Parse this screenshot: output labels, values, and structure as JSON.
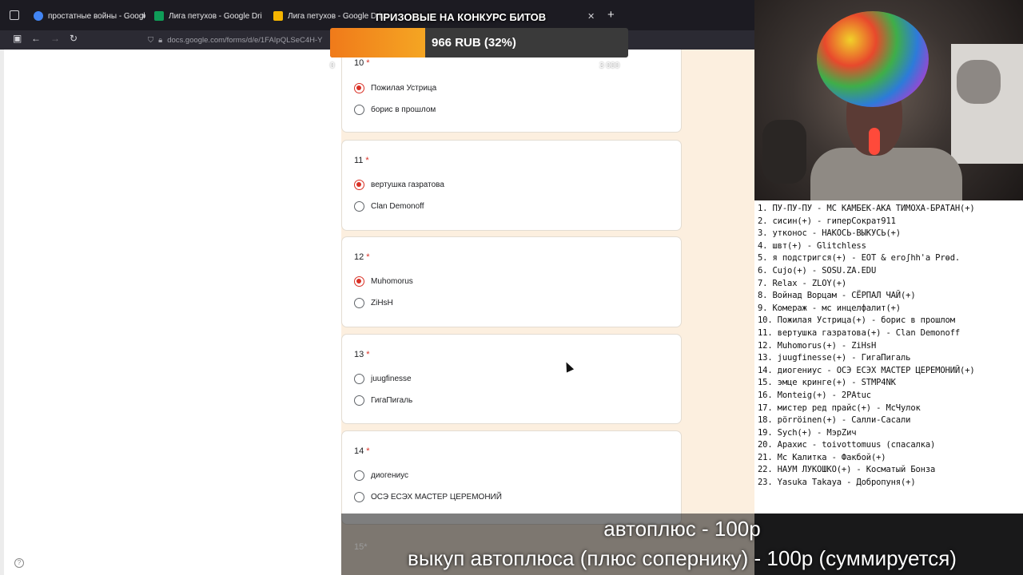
{
  "browser": {
    "tabs": [
      {
        "label": "простатные войны - Google Sh",
        "favicon_color": "#4285f4"
      },
      {
        "label": "Лига петухов - Google Drive",
        "favicon_color": "#0f9d58"
      },
      {
        "label": "Лига петухов - Google Drive",
        "favicon_color": "#f4b400"
      }
    ],
    "url": "docs.google.com/forms/d/e/1FAIpQLSeC4H-Y"
  },
  "form": {
    "questions": [
      {
        "number": "10",
        "options": [
          {
            "label": "Пожилая Устрица",
            "selected": true
          },
          {
            "label": "борис в прошлом",
            "selected": false
          }
        ]
      },
      {
        "number": "11",
        "options": [
          {
            "label": "вертушка газратова",
            "selected": true
          },
          {
            "label": "Clan Demonoff",
            "selected": false
          }
        ]
      },
      {
        "number": "12",
        "options": [
          {
            "label": "Muhomorus",
            "selected": true
          },
          {
            "label": "ZiHsH",
            "selected": false
          }
        ]
      },
      {
        "number": "13",
        "options": [
          {
            "label": "juugfinesse",
            "selected": false
          },
          {
            "label": "ГигаПигаль",
            "selected": false
          }
        ]
      },
      {
        "number": "14",
        "options": [
          {
            "label": "диогениус",
            "selected": false
          },
          {
            "label": "ОСЭ ЕСЭХ МАСТЕР ЦЕРЕМОНИЙ",
            "selected": false
          }
        ]
      }
    ],
    "next_question_peek": "15",
    "required_mark": "*"
  },
  "goal": {
    "title": "ПРИЗОВЫЕ НА КОНКУРС БИТОВ",
    "text": "966 RUB (32%)",
    "progress": 0.32,
    "min": "0",
    "max": "3 000"
  },
  "matchups": [
    "1. ПУ-ПУ-ПУ - МС КАМБЕК-АКА ТИМОХА-БРАТАН(+)",
    "2. сисин(+) - гиперСократ911",
    "3. утконос - НАКОСЬ-ВЫКУСЬ(+)",
    "4. швт(+) - Glitchless",
    "5. я подстригся(+) - EOT & eroʃhh'a Prɵd.",
    "6. Cujo(+) - SOSU.ZA.EDU",
    "7. Relax - ZLOY(+)",
    "8. Войнад Ворцам - СЁРПАЛ ЧАЙ(+)",
    "9. Комераж - мс инцелфалит(+)",
    "10. Пожилая Устрица(+) - борис в прошлом",
    "11. вертушка газратова(+) - Clan Demonoff",
    "12. Muhomorus(+) - ZiHsH",
    "13. juugfinesse(+) - ГигаПигаль",
    "14. диогениус - ОСЭ ЕСЭХ МАСТЕР ЦЕРЕМОНИЙ(+)",
    "15. эмце кринге(+) - STMP4NK",
    "16. Monteig(+) - 2PAtuc",
    "17. мистер ред прайс(+) - МсЧулок",
    "18. pörröinen(+) - Салли-Сасали",
    "19. Sych(+) - МэрZич",
    "20. Арахис - toivottomuus (спасалка)",
    "21. Мс Калитка - Факбой(+)",
    "22. НАУМ ЛУКОШКО(+) - Косматый Бонза",
    "23. Yasuka Takaya - Добропуня(+)"
  ],
  "captions": {
    "line1": "автоплюс - 100р",
    "line2": "выкуп автоплюса (плюс сопернику) - 100р (суммируется)"
  },
  "colors": {
    "accent": "#d93025",
    "goal_fill": "#f07a1a",
    "form_bg": "#fcefdf"
  }
}
